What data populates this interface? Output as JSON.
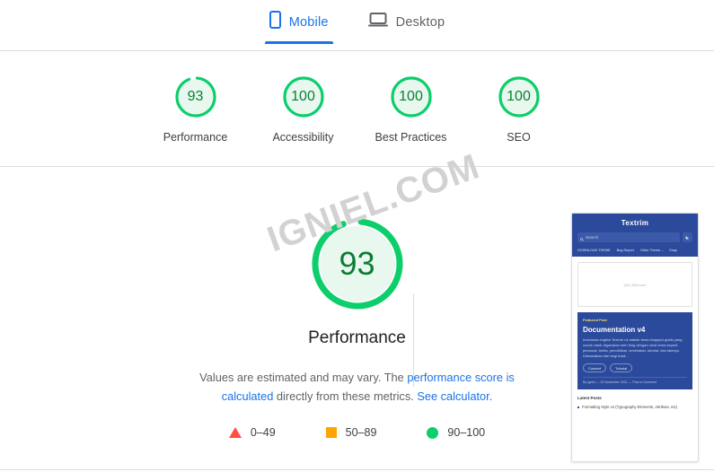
{
  "tabs": [
    {
      "label": "Mobile",
      "icon": "mobile-phone-icon",
      "active": true
    },
    {
      "label": "Desktop",
      "icon": "laptop-icon",
      "active": false
    }
  ],
  "colors": {
    "green": "#0cce6b",
    "green_text": "#0b7d33",
    "green_fill": "#e8f8ef",
    "orange": "#ffa400",
    "red": "#ff4e42",
    "blue": "#1a73e8"
  },
  "summary_scores": [
    {
      "value": "93",
      "label": "Performance",
      "percent": 93
    },
    {
      "value": "100",
      "label": "Accessibility",
      "percent": 100
    },
    {
      "value": "100",
      "label": "Best Practices",
      "percent": 100
    },
    {
      "value": "100",
      "label": "SEO",
      "percent": 100
    }
  ],
  "detail": {
    "score": "93",
    "score_percent": 93,
    "caption": "Performance",
    "disclaimer_prefix": "Values are estimated and may vary. The ",
    "link_primary": "performance score is calculated",
    "disclaimer_middle": " directly from these metrics. ",
    "link_secondary": "See calculator.",
    "legend": [
      {
        "shape": "triangle",
        "range": "0–49"
      },
      {
        "shape": "square",
        "range": "50–89"
      },
      {
        "shape": "circle",
        "range": "90–100"
      }
    ]
  },
  "watermark": "IGNIEL.COM",
  "thumbnail": {
    "site_title": "Textrim",
    "search_placeholder": "Search",
    "nav": [
      "DOWNLOAD THEME",
      "Bug Report",
      "Other Theme –",
      "Enqu"
    ],
    "placeholder_box": "(AD) Billboard",
    "featured_badge": "Featured Post",
    "post_title": "Documentation v4",
    "post_body": "Indonesia english Textrim v4 adalah tema blogspot gratis yang cocok untuk digunakan oleh blog dengan versi tema seperti personal, berita, pendidikan, kesehatan, tutorial, dan lainnya. Disesuaikan dari segi hasil...",
    "pills": [
      "Content",
      "Tutorial"
    ],
    "byline": "By igniel — 10 November 2021 — Post a Comment",
    "latest_heading": "Latest Posts",
    "latest_items": [
      "Formatting Style v4 (Typography Elements, Attribute, etc)"
    ]
  }
}
